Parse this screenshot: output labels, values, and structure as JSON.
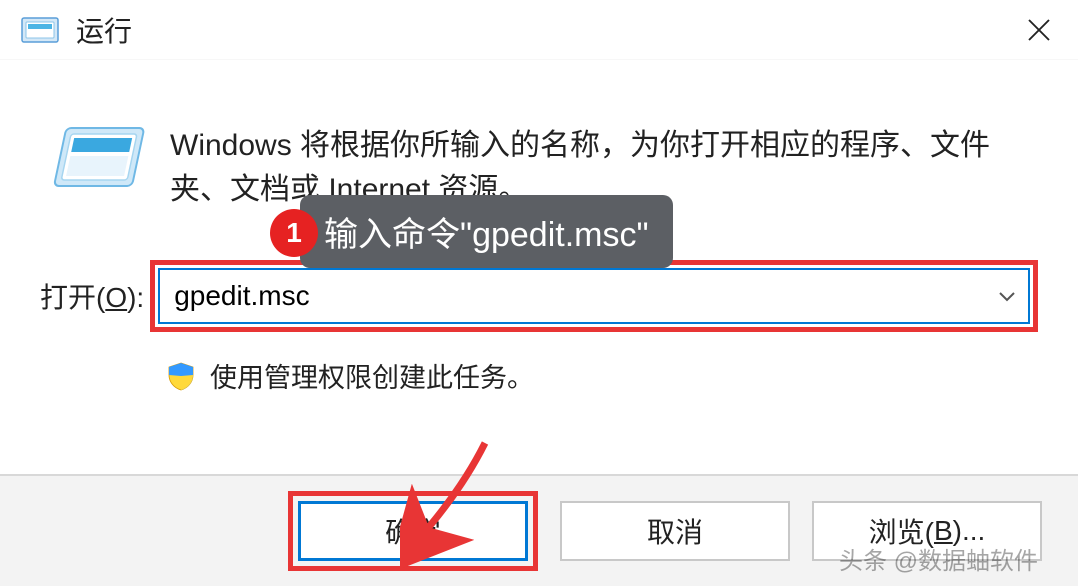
{
  "titlebar": {
    "title": "运行"
  },
  "description": "Windows 将根据你所输入的名称，为你打开相应的程序、文件夹、文档或 Internet 资源。",
  "input": {
    "label_prefix": "打开(",
    "label_key": "O",
    "label_suffix": "):",
    "value": "gpedit.msc"
  },
  "admin_note": "使用管理权限创建此任务。",
  "buttons": {
    "ok": "确定",
    "cancel": "取消",
    "browse_prefix": "浏览(",
    "browse_key": "B",
    "browse_suffix": ")..."
  },
  "callout": {
    "badge": "1",
    "text": "输入命令\"gpedit.msc\""
  },
  "watermark": "头条 @数据蚰软件"
}
